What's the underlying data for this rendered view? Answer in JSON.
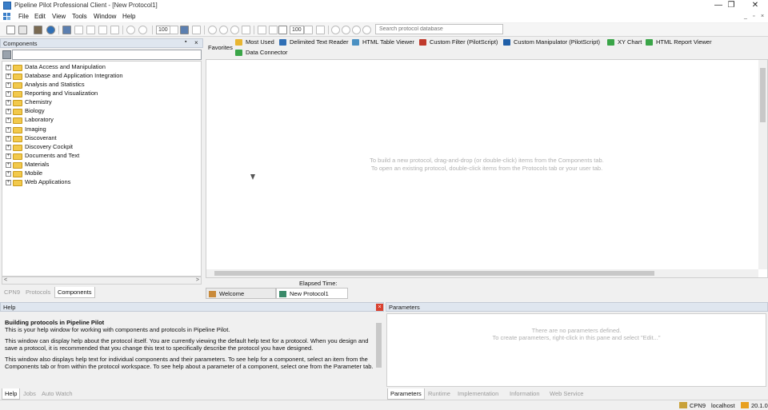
{
  "window": {
    "title": "Pipeline Pilot Professional Client - [New Protocol1]",
    "min_glyph": "—",
    "restore_glyph": "❐",
    "close_glyph": "✕"
  },
  "menu": {
    "items": [
      "File",
      "Edit",
      "View",
      "Tools",
      "Window",
      "Help"
    ],
    "mdi_controls": [
      "_",
      "▫",
      "×"
    ]
  },
  "toolbar": {
    "zoom1": "100",
    "zoom2": "100",
    "search_placeholder": "Search protocol database"
  },
  "components": {
    "title": "Components",
    "pin_glyph": "▪",
    "close_glyph": "×",
    "tree": [
      "Data Access and Manipulation",
      "Database and Application Integration",
      "Analysis and Statistics",
      "Reporting and Visualization",
      "Chemistry",
      "Biology",
      "Laboratory",
      "Imaging",
      "Discoverant",
      "Discovery Cockpit",
      "Documents and Text",
      "Materials",
      "Mobile",
      "Web Applications"
    ],
    "tabs": [
      "CPN9",
      "Protocols",
      "Components"
    ],
    "active_tab": "Components"
  },
  "favorites": {
    "label": "Favorites",
    "items": [
      {
        "label": "Most Used",
        "icon": "folder-icon",
        "color": "#e8b530"
      },
      {
        "label": "Delimited Text Reader",
        "icon": "reader-icon",
        "color": "#2f6fb5"
      },
      {
        "label": "HTML Table Viewer",
        "icon": "viewer-icon",
        "color": "#4a90c2"
      },
      {
        "label": "Custom Filter (PilotScript)",
        "icon": "filter-icon",
        "color": "#c0392b"
      },
      {
        "label": "Custom Manipulator (PilotScript)",
        "icon": "manipulator-icon",
        "color": "#1f5fa8"
      },
      {
        "label": "XY Chart",
        "icon": "chart-icon",
        "color": "#3aa548"
      },
      {
        "label": "HTML Report Viewer",
        "icon": "report-icon",
        "color": "#3aa548"
      },
      {
        "label": "Data Connector",
        "icon": "connector-icon",
        "color": "#3aa548"
      }
    ]
  },
  "canvas": {
    "hint_line1": "To build a new protocol, drag-and-drop (or double-click) items from the Components tab.",
    "hint_line2": "To open an existing protocol, double-click items from the Protocols tab or your user tab.",
    "elapsed_label": "Elapsed Time:"
  },
  "doc_tabs": [
    "Welcome",
    "New Protocol1"
  ],
  "help": {
    "title": "Help",
    "heading": "Building protocols in Pipeline Pilot",
    "p1": "This is your help window for working with components and protocols in Pipeline Pilot.",
    "p2": "This window can display help about the protocol itself. You are currently viewing the default help text for a protocol. When you design and save a protocol, it is recommended that you change this text to specifically describe the protocol you have designed.",
    "p3": "This window also displays help text for individual components and their parameters. To see help for a component, select an item from the Components tab or from within the protocol workspace. To see help about a parameter of a component, select one from the Parameter tab.",
    "tabs": [
      "Help",
      "Jobs",
      "Auto Watch"
    ],
    "active_tab": "Help"
  },
  "parameters": {
    "title": "Parameters",
    "hint_line1": "There are no parameters defined.",
    "hint_line2": "To create parameters, right-click in this pane and select \"Edit...\"",
    "tabs": [
      "Parameters",
      "Runtime",
      "Implementation",
      "Information",
      "Web Service"
    ],
    "active_tab": "Parameters"
  },
  "status": {
    "server": "CPN9",
    "host": "localhost",
    "version": "20.1.0"
  }
}
